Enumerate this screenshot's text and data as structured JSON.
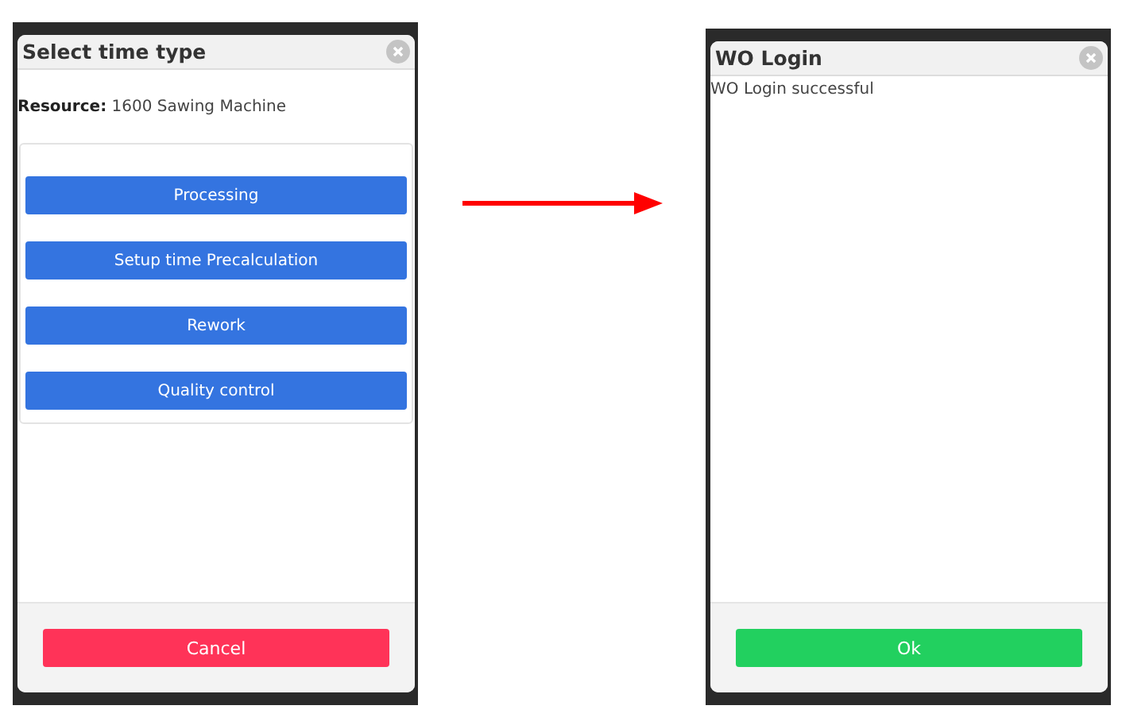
{
  "screens": [
    {
      "title": "Select time type",
      "resource": {
        "label": "Resource:",
        "value": "1600 Sawing Machine"
      },
      "options": [
        "Processing",
        "Setup time Precalculation",
        "Rework",
        "Quality control"
      ],
      "footer_button": {
        "label": "Cancel",
        "kind": "cancel"
      }
    },
    {
      "title": "WO Login",
      "message": "WO Login successful",
      "footer_button": {
        "label": "Ok",
        "kind": "confirm"
      }
    }
  ]
}
